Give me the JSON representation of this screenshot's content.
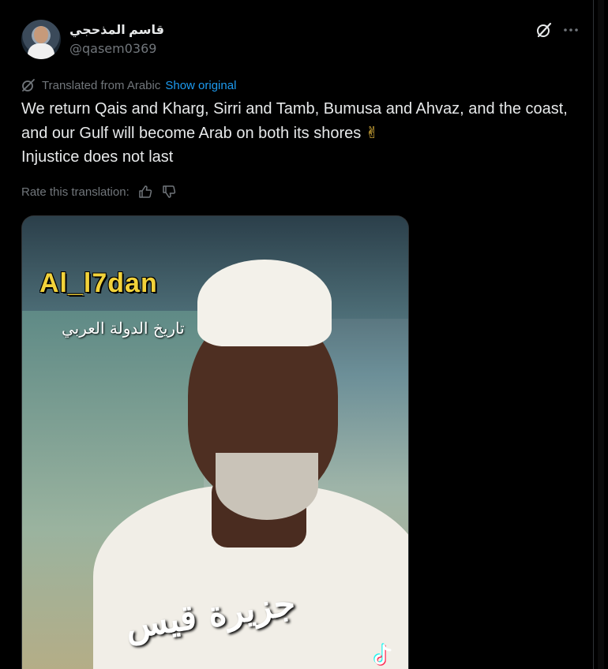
{
  "user": {
    "display_name": "قاسم المذحجي",
    "handle": "@qasem0369"
  },
  "translation": {
    "label": "Translated from Arabic",
    "show_original": "Show original",
    "rate_label": "Rate this translation:"
  },
  "tweet": {
    "line1": "We return Qais and Kharg, Sirri and Tamb, Bumusa and Ahvaz, and the coast, and our Gulf will become Arab on both its shores ",
    "emoji": "✌",
    "line2": "Injustice does not last"
  },
  "media": {
    "watermark": "Al_l7dan",
    "sub_watermark": "تاريخ الدولة العربي",
    "caption": "جزيرة قيس"
  },
  "colors": {
    "background": "#000000",
    "text": "#e7e9ea",
    "muted": "#71767b",
    "link": "#1d9bf0",
    "border": "#2f3336"
  }
}
